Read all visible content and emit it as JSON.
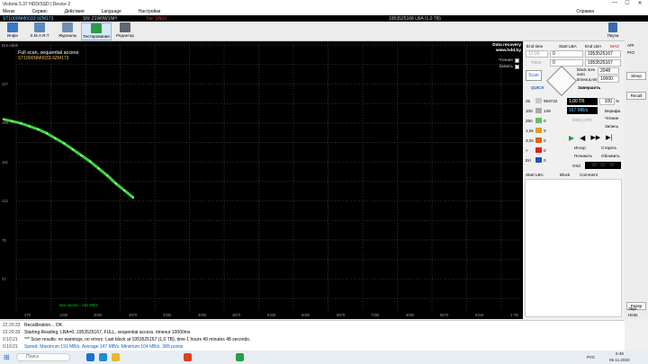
{
  "window": {
    "title": "Victoria 5.37 HDD/SSD | Device 2",
    "minimize": "—",
    "maximize": "☐",
    "close": "✕"
  },
  "menu": {
    "items": [
      "Меню",
      "Сервис",
      "Действия",
      "Language",
      "Настройки"
    ],
    "right": "Справка"
  },
  "status_line": {
    "model": "ST1000NM0033-9ZM173",
    "serial": "SN: Z1W0W1NH",
    "fw": "Fw: SN03",
    "capacity": "1953525168 LBA (1,0 TB)"
  },
  "toolbar": {
    "buttons": [
      {
        "label": "Инфо",
        "icon": "info-icon"
      },
      {
        "label": "S.M.A.R.T",
        "icon": "smart-icon"
      },
      {
        "label": "Журналы",
        "icon": "journal-icon"
      },
      {
        "label": "Тестирование",
        "icon": "test-icon"
      },
      {
        "label": "Редактор",
        "icon": "editor-icon"
      }
    ],
    "right_buttons": [
      {
        "label": "Пауза"
      },
      {
        "label": "Стоп"
      }
    ]
  },
  "graph": {
    "header": "Drv mb/s",
    "title": "Full scan, sequential access",
    "model": "ST1000NM0033-9ZM173",
    "logo_line1": "Data recovery",
    "logo_line2": "www.hdd.by",
    "checkbox_read": "Чтение",
    "checkbox_write": "Запись",
    "max_speed": "Max speed = 191 MB/s",
    "y_labels": [
      "227",
      "189",
      "151",
      "113",
      "75",
      "37"
    ],
    "x_labels": [
      "470",
      "1330",
      "2000",
      "2670",
      "3330",
      "4000",
      "4670",
      "5330",
      "6000",
      "6670",
      "7330",
      "8000",
      "8670",
      "9340",
      "1 TB"
    ]
  },
  "chart_data": {
    "type": "line",
    "title": "Full scan, sequential access",
    "ylabel": "Drv mb/s",
    "ylim": [
      0,
      264
    ],
    "series": [
      {
        "name": "Чтение",
        "x": [
          0,
          10,
          20,
          30,
          40,
          50,
          60,
          70,
          80,
          90,
          100,
          110,
          120,
          130,
          140,
          150
        ],
        "values": [
          190,
          188,
          186,
          183,
          180,
          176,
          171,
          166,
          160,
          154,
          148,
          141,
          134,
          126,
          119,
          112
        ]
      }
    ]
  },
  "right_panel": {
    "end_time_label": "End time",
    "start_lba_label": "Start LBA",
    "end_lba_label": "End LBA",
    "max_label": "MAX",
    "end_time": "12:00",
    "start_lba": "0",
    "end_lba": "1953525167",
    "timer_label": "Timer",
    "timer_value": "0",
    "cur_lba": "1953525167",
    "block_size_label": "block size",
    "auto_label": "auto",
    "block_size": "2048",
    "timeout_label": "timeout,ms",
    "timeout": "10000",
    "scan_button": "Scan",
    "quick_label": "QUICK",
    "finished_label": "Завершить",
    "size_value": "1,00 TB",
    "percent_value": "100",
    "percent_sign": "%",
    "speed_value": "167 MB/s",
    "ddd_label": "DDD (API)",
    "mode_verify": "Верифи.",
    "mode_read": "Чтение",
    "mode_write": "Запись",
    "blocks": [
      {
        "label": "25",
        "count": "953722",
        "color": "#c8c8c8"
      },
      {
        "label": "100",
        "count": "149",
        "color": "#a8a8a8"
      },
      {
        "label": "250",
        "count": "0",
        "color": "#60c060"
      },
      {
        "label": "1,0s",
        "count": "0",
        "color": "#e0a020"
      },
      {
        "label": "3,0s",
        "count": "0",
        "color": "#e06010"
      },
      {
        "label": ">",
        "count": "0",
        "color": "#e02020"
      },
      {
        "label": "Err",
        "count": "0",
        "color": "#2050c0"
      }
    ],
    "action_ignore": "Игнор",
    "action_erase": "Стереть",
    "action_remap": "Починить",
    "action_refresh": "Обновить",
    "grid_label": "Grid",
    "grid_time": "00 : 00 : 00",
    "table_headers": [
      "Start LBA",
      "Block",
      "Comment"
    ]
  },
  "right_strip": {
    "api": "API",
    "pio": "PIO",
    "sleep": "Sleep",
    "recall": "Recall",
    "passp": "Passp",
    "sound": "Звук",
    "hints": "Hints"
  },
  "log": [
    {
      "time": "22:20:33",
      "text": "Recalibration... OK",
      "color": "#000"
    },
    {
      "time": "22:20:33",
      "text": "Starting Reading, LBA=0..1953525167, FULL, sequential access, timeout 10000ms",
      "color": "#000"
    },
    {
      "time": "0:10:21",
      "text": "*** Scan results: no warnings, no errors. Last block at 1953525167 (1,0 TB), time 1 hours 49 minutes 48 seconds.",
      "color": "#000"
    },
    {
      "time": "0:10:21",
      "text": "Speed: Maximum 191 MB/s. Average 147 MB/s. Minimum 104 MB/s. 389 points.",
      "color": "#1060c0"
    }
  ],
  "taskbar": {
    "search_placeholder": "Поиск",
    "lang": "РУС",
    "time": "5:46",
    "date": "06.11.2023"
  }
}
